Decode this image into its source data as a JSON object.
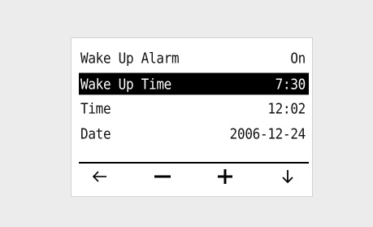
{
  "menu": {
    "items": [
      {
        "label": "Wake Up Alarm",
        "value": "On",
        "selected": false
      },
      {
        "label": "Wake Up Time",
        "value": "7:30",
        "selected": true
      },
      {
        "label": "Time",
        "value": "12:02",
        "selected": false
      },
      {
        "label": "Date",
        "value": "2006-12-24",
        "selected": false
      }
    ]
  },
  "softkeys": {
    "icons": [
      "back-arrow-icon",
      "minus-icon",
      "plus-icon",
      "down-arrow-icon"
    ]
  },
  "colors": {
    "background": "#ececec",
    "screen": "#ffffff",
    "selection": "#000000",
    "text": "#111111"
  }
}
